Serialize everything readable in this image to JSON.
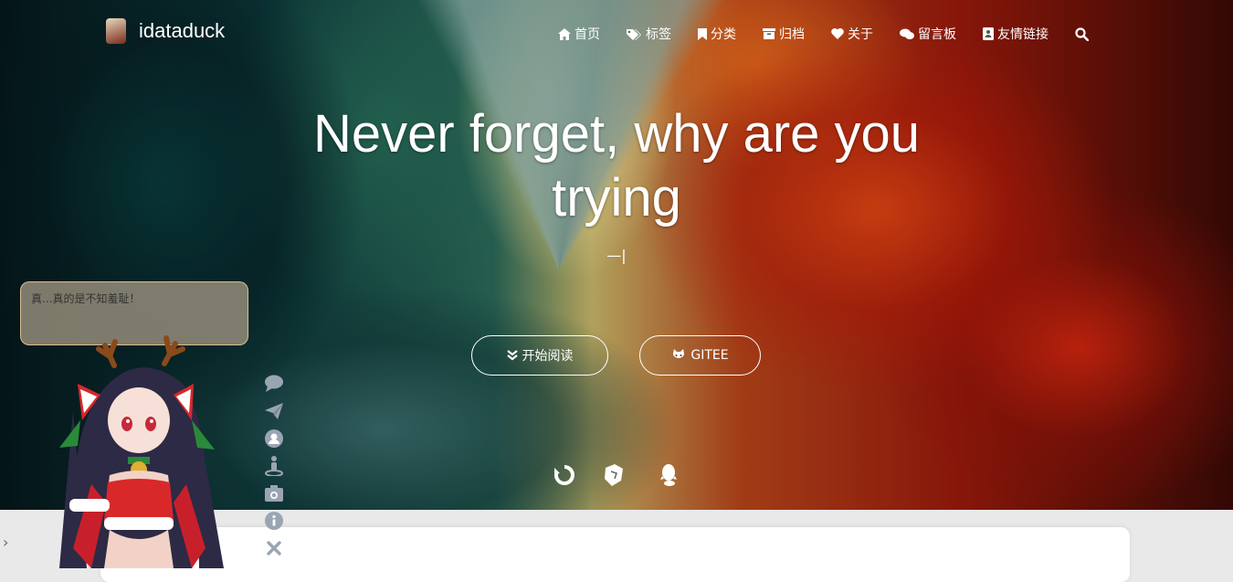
{
  "brand": {
    "name": "idataduck",
    "logo_icon": "avatar-icon"
  },
  "nav": {
    "items": [
      {
        "label": "首页",
        "icon": "home-icon"
      },
      {
        "label": "标签",
        "icon": "tags-icon"
      },
      {
        "label": "分类",
        "icon": "bookmark-icon"
      },
      {
        "label": "归档",
        "icon": "archive-icon"
      },
      {
        "label": "关于",
        "icon": "heart-icon"
      },
      {
        "label": "留言板",
        "icon": "comments-icon"
      },
      {
        "label": "友情链接",
        "icon": "address-book-icon"
      }
    ],
    "search_icon": "search-icon"
  },
  "hero": {
    "title": "Never forget, why are you trying",
    "subtitle": "—|",
    "buttons": [
      {
        "label": "开始阅读",
        "icon": "angle-double-down-icon"
      },
      {
        "label": "GITEE",
        "icon": "gitee-icon"
      }
    ],
    "social_icons": [
      "refresh-icon",
      "cube-icon",
      "qq-icon"
    ]
  },
  "mascot": {
    "speech": "真...真的是不知羞耻！",
    "tools": [
      "comment-icon",
      "paper-plane-icon",
      "user-circle-icon",
      "street-view-icon",
      "camera-icon",
      "info-circle-icon",
      "close-icon"
    ]
  },
  "sidebar_toggle": "›",
  "colors": {
    "nav_text": "#ffffff",
    "button_border": "#ffffff",
    "tool_icon": "#9aa5b3",
    "bottom_bg": "#e9e9ea"
  }
}
